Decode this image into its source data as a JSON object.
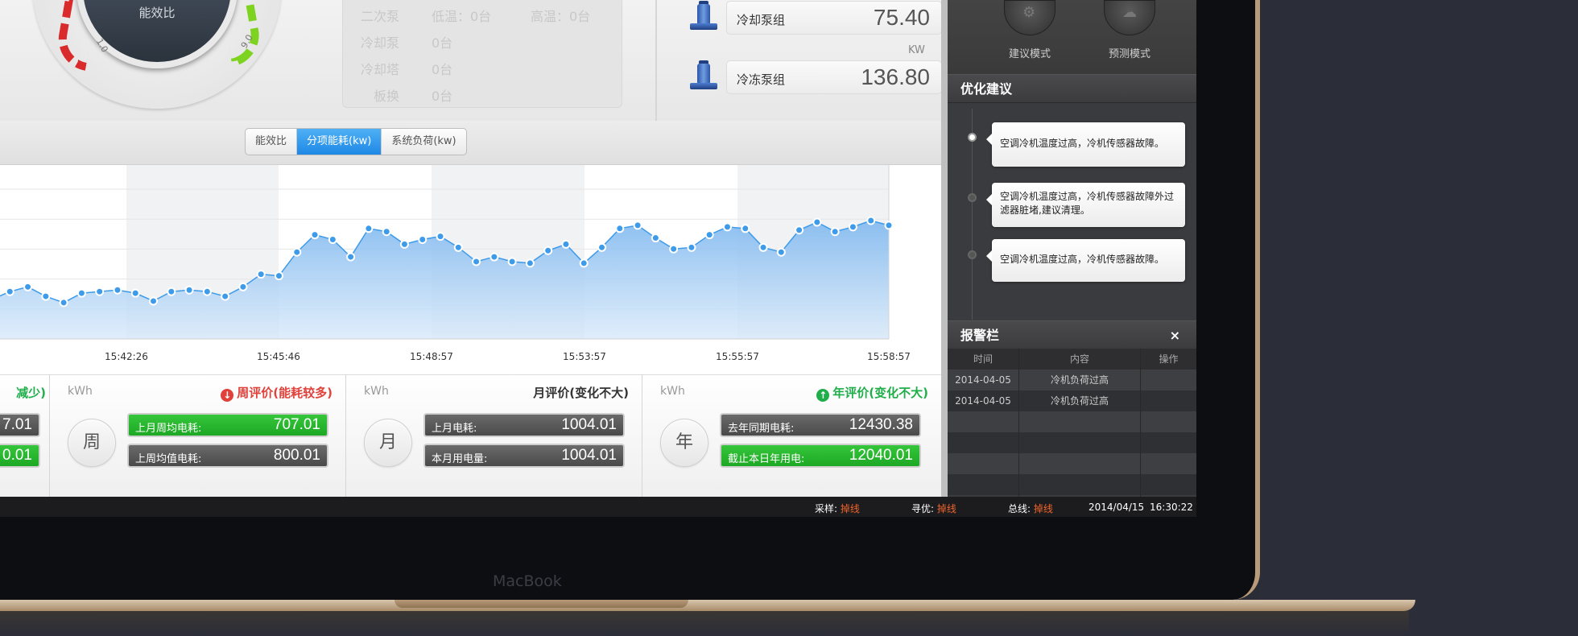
{
  "gauge": {
    "label": "能效比",
    "tick_left": "1.0",
    "tick_right": "9.0"
  },
  "equipment": [
    {
      "name": "二次泵",
      "col1": "低温：0台",
      "col2": "高温：0台"
    },
    {
      "name": "冷却泵",
      "col1": "0台",
      "col2": ""
    },
    {
      "name": "冷却塔",
      "col1": "0台",
      "col2": ""
    },
    {
      "name": "板换",
      "col1": "0台",
      "col2": ""
    }
  ],
  "pumps": [
    {
      "name": "冷却泵组",
      "value": "75.40"
    },
    {
      "name": "冷冻泵组",
      "value": "136.80"
    }
  ],
  "pump_unit": "KW",
  "tabs": [
    {
      "label": "能效比"
    },
    {
      "label": "分项能耗(kw)"
    },
    {
      "label": "系统负荷(kw)"
    }
  ],
  "active_tab": "分项能耗(kw)",
  "chart_data": {
    "type": "area",
    "x_ticks": [
      "15:42:26",
      "15:45:46",
      "15:48:57",
      "15:53:57",
      "15:55:57",
      "15:58:57"
    ],
    "values": [
      25,
      30,
      33,
      27,
      23,
      29,
      30,
      31,
      29,
      24,
      30,
      31,
      30,
      27,
      33,
      41,
      40,
      55,
      66,
      63,
      52,
      70,
      68,
      60,
      63,
      65,
      58,
      49,
      52,
      49,
      48,
      56,
      60,
      48,
      58,
      70,
      72,
      64,
      57,
      58,
      66,
      71,
      70,
      58,
      55,
      69,
      74,
      68,
      71,
      75,
      72
    ],
    "ylim": [
      0,
      100
    ],
    "color": "#3d9be9"
  },
  "stats": {
    "partial": {
      "title_fragment": "减少)",
      "values": [
        "7.01",
        "0.01"
      ]
    },
    "week": {
      "unit": "kWh",
      "title": "周评价(能耗较多)",
      "circle": "周",
      "rows": [
        {
          "label": "上月周均电耗:",
          "value": "707.01",
          "style": "green"
        },
        {
          "label": "上周均值电耗:",
          "value": "800.01",
          "style": "gray"
        }
      ]
    },
    "month": {
      "unit": "kWh",
      "title": "月评价(变化不大)",
      "circle": "月",
      "rows": [
        {
          "label": "上月电耗:",
          "value": "1004.01",
          "style": "gray"
        },
        {
          "label": "本月用电量:",
          "value": "1004.01",
          "style": "gray"
        }
      ]
    },
    "year": {
      "unit": "kWh",
      "title": "年评价(变化不大)",
      "circle": "年",
      "rows": [
        {
          "label": "去年同期电耗:",
          "value": "12430.38",
          "style": "gray"
        },
        {
          "label": "截止本日年用电:",
          "value": "12040.01",
          "style": "green"
        }
      ]
    }
  },
  "status": {
    "sample_label": "采样:",
    "sample_value": "掉线",
    "optimize_label": "寻优:",
    "optimize_value": "掉线",
    "bus_label": "总线:",
    "bus_value": "掉线",
    "date": "2014/04/15",
    "time": "16:30:22"
  },
  "sidebar": {
    "modes": [
      {
        "label": "建议模式"
      },
      {
        "label": "预测模式"
      }
    ],
    "suggest_title": "优化建议",
    "suggestions": [
      "空调冷机温度过高，冷机传感器故障。",
      "空调冷机温度过高，冷机传感器故障外过滤器脏堵,建议清理。",
      "空调冷机温度过高，冷机传感器故障。"
    ],
    "alarm_title": "报警栏",
    "alarm_close": "×",
    "alarm_headers": [
      "时间",
      "内容",
      "操作"
    ],
    "alarms": [
      {
        "time": "2014-04-05",
        "content": "冷机负荷过高",
        "action": ""
      },
      {
        "time": "2014-04-05",
        "content": "冷机负荷过高",
        "action": ""
      }
    ]
  },
  "bezel_brand": "MacBook",
  "colors": {
    "accent_blue": "#1e88e5",
    "alarm_red": "#e0413a",
    "ok_green": "#1fae4a",
    "status_orange": "#f0642b"
  }
}
